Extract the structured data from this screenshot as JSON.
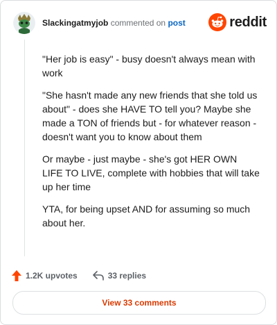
{
  "header": {
    "username": "Slackingatmyjob",
    "commented_on": "commented on",
    "post_link": "post",
    "logo_text": "reddit",
    "avatar_icon": "snoo-avatar-icon",
    "logo_icon": "reddit-snoo-icon"
  },
  "comment": {
    "paragraphs": [
      "\"Her job is easy\" - busy doesn't always mean with work",
      "\"She hasn't made any new friends that she told us about\" - does she HAVE TO tell you? Maybe she made a TON of friends but - for whatever reason - doesn't want you to know about them",
      "Or maybe - just maybe - she's got HER OWN LIFE TO LIVE, complete with hobbies that will take up her time",
      "YTA, for being upset AND for assuming so much about her."
    ]
  },
  "actions": {
    "upvotes": "1.2K upvotes",
    "replies": "33 replies",
    "upvote_icon": "upvote-arrow-icon",
    "reply_icon": "reply-arrow-icon"
  },
  "footer": {
    "view_comments": "View 33 comments"
  },
  "colors": {
    "brand_orange": "#ff4500",
    "link_blue": "#0a66c2",
    "view_button_text": "#d93a00"
  }
}
